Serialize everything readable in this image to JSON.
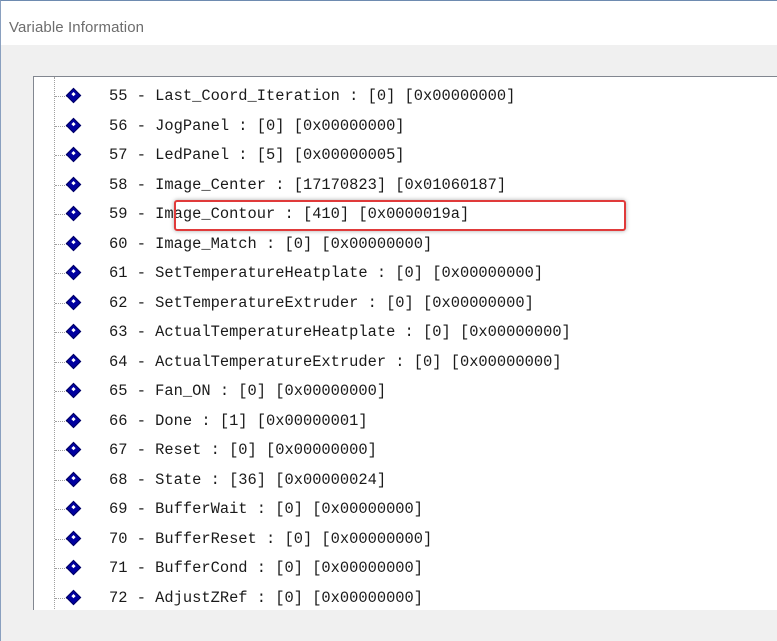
{
  "window": {
    "title": "Variable Information"
  },
  "tree": {
    "items": [
      {
        "label": "55 - Last_Coord_Iteration : [0] [0x00000000]"
      },
      {
        "label": "56 - JogPanel : [0] [0x00000000]"
      },
      {
        "label": "57 - LedPanel : [5] [0x00000005]"
      },
      {
        "label": "58 - Image_Center : [17170823] [0x01060187]"
      },
      {
        "label": "59 - Image_Contour : [410] [0x0000019a]"
      },
      {
        "label": "60 - Image_Match : [0] [0x00000000]"
      },
      {
        "label": "61 - SetTemperatureHeatplate : [0] [0x00000000]"
      },
      {
        "label": "62 - SetTemperatureExtruder : [0] [0x00000000]"
      },
      {
        "label": "63 - ActualTemperatureHeatplate : [0] [0x00000000]"
      },
      {
        "label": "64 - ActualTemperatureExtruder : [0] [0x00000000]"
      },
      {
        "label": "65 - Fan_ON : [0] [0x00000000]"
      },
      {
        "label": "66 - Done : [1] [0x00000001]"
      },
      {
        "label": "67 - Reset : [0] [0x00000000]"
      },
      {
        "label": "68 - State : [36] [0x00000024]"
      },
      {
        "label": "69 - BufferWait : [0] [0x00000000]"
      },
      {
        "label": "70 - BufferReset : [0] [0x00000000]"
      },
      {
        "label": "71 - BufferCond : [0] [0x00000000]"
      },
      {
        "label": "72 - AdjustZRef : [0] [0x00000000]"
      }
    ],
    "highlighted_index": 4
  },
  "colors": {
    "node_icon": "#0000a0",
    "highlight_border": "#e03a3a",
    "panel_background": "#ffffff",
    "window_background": "#f0f0f0"
  },
  "icons": {
    "tree_node": "diamond-node-icon"
  }
}
